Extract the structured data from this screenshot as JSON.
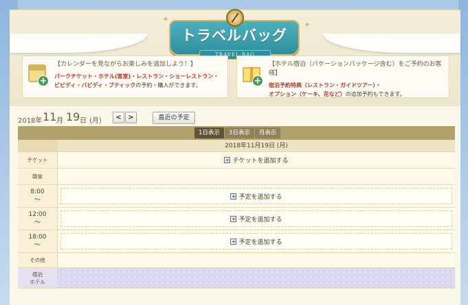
{
  "header": {
    "title": "トラベルバッグ",
    "subtitle": "TRAVEL BAG"
  },
  "info": [
    {
      "icon": "calendar-plus-icon",
      "heading": "【カレンダーを見ながらお楽しみを追加しよう！】",
      "line1_red": "パークチケット・ホテル(客室)・レストラン・ショーレストラン・",
      "line2_red": "ビビディ・バビディ・ブティック",
      "line2_plain": "の予約・購入ができます。"
    },
    {
      "icon": "gift-plus-icon",
      "heading": "【ホテル宿泊（バケーションパッケージ含む）をご予約のお客様】",
      "line1_red": "宿泊予約特典（レストラン・ガイドツアー）・",
      "line2_red": "オプション（ケーキ、花など）",
      "line2_plain": "の追加予約もできます。"
    }
  ],
  "date_nav": {
    "year": "2018年",
    "month": "11",
    "month_unit": "月",
    "day": "19",
    "day_unit": "日",
    "weekday": "(月)",
    "prev_label": "<",
    "next_label": ">",
    "recent_label": "直近の予定"
  },
  "view_tabs": [
    {
      "label": "1日表示",
      "active": true
    },
    {
      "label": "3日表示",
      "active": false
    },
    {
      "label": "月表示",
      "active": false
    }
  ],
  "calendar": {
    "date_header": "2018年11月19日 (月)",
    "rows": {
      "ticket": {
        "label": "チケット",
        "action": "チケットを追加する"
      },
      "breakfast": {
        "label": "朝食"
      },
      "slot_8": {
        "time": "8:00",
        "tilde": "〜",
        "action": "予定を追加する"
      },
      "slot_12": {
        "time": "12:00",
        "tilde": "〜",
        "action": "予定を追加する"
      },
      "slot_18": {
        "time": "18:00",
        "tilde": "〜",
        "action": "予定を追加する"
      },
      "other": {
        "label": "その他"
      },
      "hotel": {
        "label1": "宿泊",
        "label2": "ホテル"
      }
    }
  },
  "colors": {
    "banner": "#2f8f9e",
    "gold": "#d9b86a",
    "red_text": "#b03a2e",
    "table_header": "#b0a06b",
    "active_tab": "#5e5336"
  }
}
